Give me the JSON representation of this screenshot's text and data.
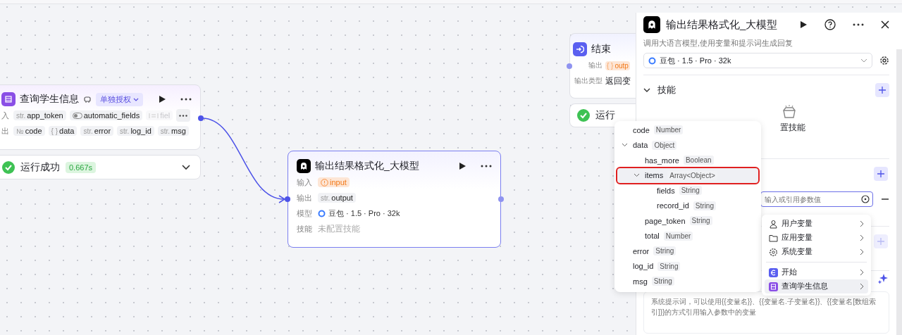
{
  "canvas": {
    "plugin_node": {
      "title": "查询学生信息",
      "badge": "单独授权",
      "rows": [
        {
          "label": "入",
          "chips": [
            {
              "kind": "str",
              "prefix": "str.",
              "name": "app_token",
              "faded": false
            },
            {
              "kind": "toggle",
              "name": "automatic_fields",
              "faded": false
            },
            {
              "kind": "list",
              "name": "fiel",
              "faded": true
            }
          ],
          "more": true
        },
        {
          "label": "出",
          "chips": [
            {
              "kind": "str",
              "prefix": "№",
              "name": "code",
              "faded": false
            },
            {
              "kind": "str",
              "prefix": "{ }",
              "name": "data",
              "faded": false
            },
            {
              "kind": "str",
              "prefix": "str.",
              "name": "error",
              "faded": false
            },
            {
              "kind": "str",
              "prefix": "str.",
              "name": "log_id",
              "faded": false
            },
            {
              "kind": "str",
              "prefix": "str.",
              "name": "msg",
              "faded": false
            }
          ],
          "more": false
        }
      ]
    },
    "plugin_status": {
      "text": "运行成功",
      "duration": "0.667s"
    },
    "llm_node": {
      "title": "输出结果格式化_大模型",
      "selected": true,
      "rows": [
        {
          "label": "输入",
          "kind": "warning",
          "value": "input"
        },
        {
          "label": "输出",
          "kind": "chip",
          "prefix": "str.",
          "value": "output"
        },
        {
          "label": "模型",
          "kind": "model",
          "value": "豆包 · 1.5 · Pro · 32k"
        },
        {
          "label": "技能",
          "kind": "muted",
          "value": "未配置技能"
        }
      ]
    },
    "end_node": {
      "title": "结束",
      "rows": [
        {
          "label": "输出",
          "kind": "warning",
          "prefix": "{ }",
          "value": "outp"
        },
        {
          "label": "输出类型",
          "kind": "text",
          "value": "返回变"
        }
      ]
    },
    "end_status": {
      "text": "运行"
    }
  },
  "panel": {
    "title": "输出结果格式化_大模型",
    "description": "调用大语言模型,使用变量和提示词生成回复",
    "model": "豆包 · 1.5 · Pro · 32k",
    "skills": {
      "title": "技能",
      "expanded": true,
      "empty_text": "置技能"
    },
    "input_placeholder": "输入或引用参数值",
    "prompt_placeholder": "系统提示词，可以使用{{变量名}}、{{变量名.子变量名}}、{{变量名[数组索引]}}的方式引用输入参数中的变量"
  },
  "variable_tree": [
    {
      "name": "code",
      "type": "Number",
      "highlighted": false
    },
    {
      "name": "data",
      "type": "Object",
      "expanded": true,
      "highlighted": false,
      "children": [
        {
          "name": "has_more",
          "type": "Boolean",
          "highlighted": false
        },
        {
          "name": "items",
          "type": "Array<Object>",
          "expanded": true,
          "highlighted": true,
          "children": [
            {
              "name": "fields",
              "type": "String",
              "highlighted": false
            },
            {
              "name": "record_id",
              "type": "String",
              "highlighted": false
            }
          ]
        },
        {
          "name": "page_token",
          "type": "String",
          "highlighted": false
        },
        {
          "name": "total",
          "type": "Number",
          "highlighted": false
        }
      ]
    },
    {
      "name": "error",
      "type": "String",
      "highlighted": false
    },
    {
      "name": "log_id",
      "type": "String",
      "highlighted": false
    },
    {
      "name": "msg",
      "type": "String",
      "highlighted": false
    }
  ],
  "variable_menu": [
    [
      {
        "label": "用户变量",
        "kind": "user",
        "selected": false
      },
      {
        "label": "应用变量",
        "kind": "folder",
        "selected": false
      },
      {
        "label": "系统变量",
        "kind": "gear",
        "selected": false
      }
    ],
    [
      {
        "label": "开始",
        "kind": "start",
        "selected": false
      },
      {
        "label": "查询学生信息",
        "kind": "plugin",
        "selected": true
      }
    ]
  ]
}
